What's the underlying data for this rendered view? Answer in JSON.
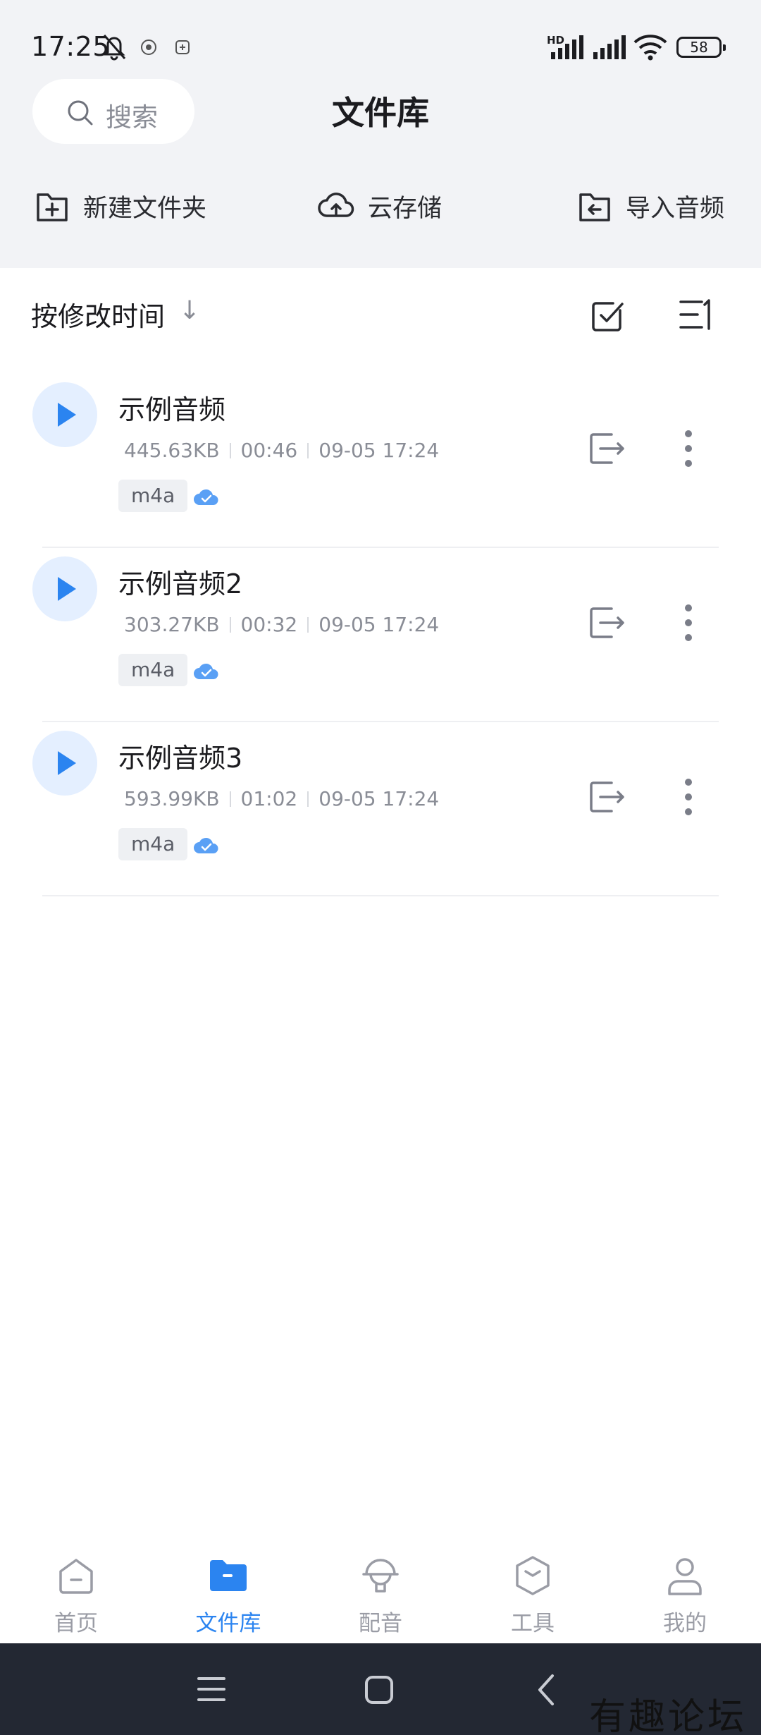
{
  "status_bar": {
    "time": "17:25",
    "network_badge": "HD",
    "battery": "58",
    "icons": [
      "bell-off-icon",
      "app-notification-icon",
      "app-notification-icon",
      "signal-icon",
      "signal-icon",
      "wifi-icon",
      "battery-icon"
    ]
  },
  "header": {
    "search_label": "搜索",
    "title": "文件库"
  },
  "actions": {
    "new_folder": "新建文件夹",
    "cloud_storage": "云存储",
    "import_audio": "导入音频"
  },
  "sort": {
    "label": "按修改时间",
    "direction_glyph": "↓"
  },
  "files": [
    {
      "name": "示例音频",
      "size": "445.63KB",
      "duration": "00:46",
      "modified": "09-05 17:24",
      "format": "m4a"
    },
    {
      "name": "示例音频2",
      "size": "303.27KB",
      "duration": "00:32",
      "modified": "09-05 17:24",
      "format": "m4a"
    },
    {
      "name": "示例音频3",
      "size": "593.99KB",
      "duration": "01:02",
      "modified": "09-05 17:24",
      "format": "m4a"
    }
  ],
  "nav": {
    "home": "首页",
    "library": "文件库",
    "dubbing": "配音",
    "tools": "工具",
    "mine": "我的",
    "active": "library"
  },
  "watermark": "有趣论坛",
  "colors": {
    "accent": "#2b84f0",
    "top_background": "#f2f3f6",
    "play_bg": "#e4efff",
    "system_nav": "#232833"
  }
}
